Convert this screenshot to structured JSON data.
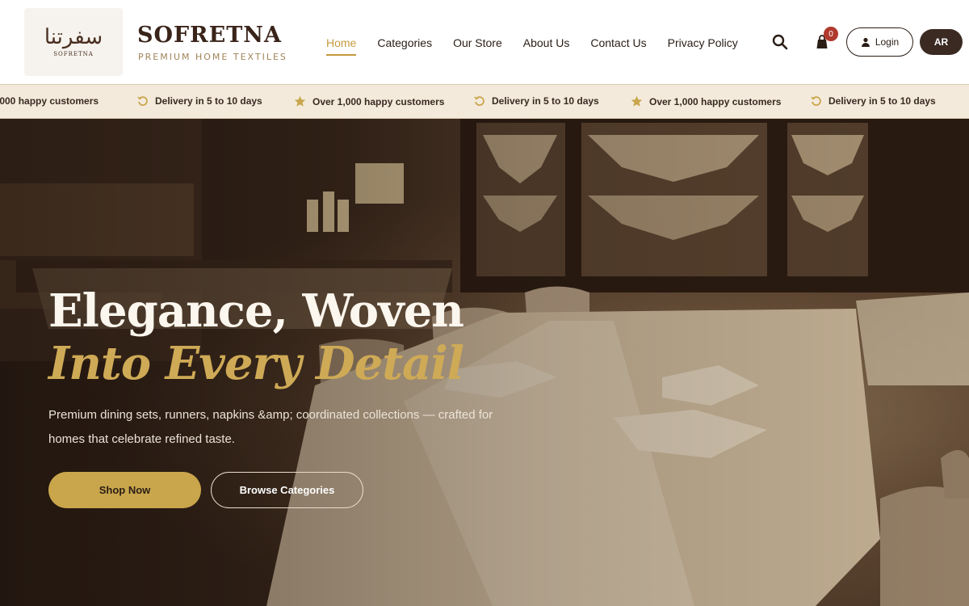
{
  "header": {
    "logo_script": "سفرتنا",
    "logo_small": "SOFRETNA",
    "brand_name": "SOFRETNA",
    "brand_tagline": "PREMIUM HOME TEXTILES",
    "nav": [
      {
        "label": "Home",
        "active": true
      },
      {
        "label": "Categories"
      },
      {
        "label": "Our Store"
      },
      {
        "label": "About Us"
      },
      {
        "label": "Contact Us"
      },
      {
        "label": "Privacy Policy"
      }
    ],
    "cart_count": "0",
    "login_label": "Login",
    "lang_label": "AR",
    "icons": [
      "search-icon",
      "cart-icon",
      "user-icon"
    ]
  },
  "ticker": {
    "items": [
      {
        "text": ",000 happy customers",
        "icon": "none"
      },
      {
        "text": "Delivery in 5 to 10 days",
        "icon": "refresh-icon"
      },
      {
        "text": "Over 1,000 happy customers",
        "icon": "star-icon"
      },
      {
        "text": "Delivery in 5 to 10 days",
        "icon": "refresh-icon"
      },
      {
        "text": "Over 1,000 happy customers",
        "icon": "star-icon"
      },
      {
        "text": "Delivery in 5 to 10 days",
        "icon": "refresh-icon"
      }
    ]
  },
  "hero": {
    "title_line1": "Elegance, Woven",
    "title_line2": "Into Every Detail",
    "subtitle": "Premium dining sets, runners, napkins &amp; coordinated collections — crafted for homes that celebrate refined taste.",
    "primary_button": "Shop Now",
    "secondary_button": "Browse Categories"
  },
  "colors": {
    "accent_gold": "#c9a64c",
    "dark_brown": "#3a2a22",
    "badge_red": "#b03a2e",
    "ticker_bg": "#f3eadb"
  }
}
